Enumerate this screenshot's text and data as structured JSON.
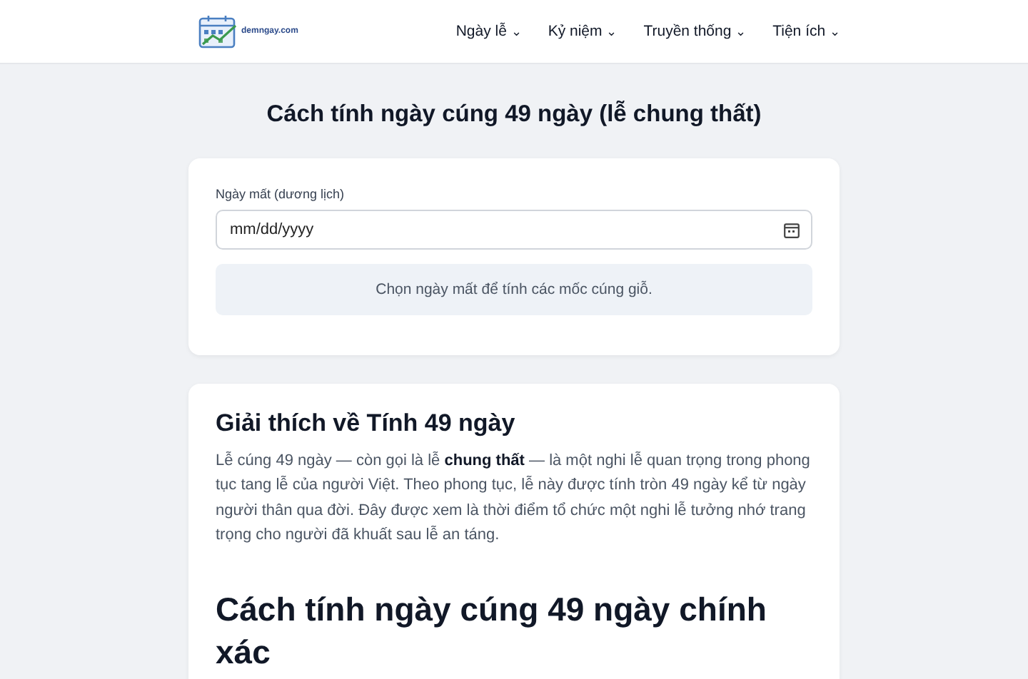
{
  "header": {
    "logo_text": "demngay.com",
    "nav": [
      {
        "label": "Ngày lễ",
        "caret": "⌄"
      },
      {
        "label": "Kỷ niệm",
        "caret": "⌄"
      },
      {
        "label": "Truyền thống",
        "caret": "⌄"
      },
      {
        "label": "Tiện ích",
        "caret": "⌄"
      }
    ]
  },
  "page_title": "Cách tính ngày cúng 49 ngày (lễ chung thất)",
  "form": {
    "label": "Ngày mất (dương lịch)",
    "placeholder": "mm/dd/yyyy",
    "hint": "Chọn ngày mất để tính các mốc cúng giỗ."
  },
  "article": {
    "heading": "Giải thích về Tính 49 ngày",
    "paragraph": "Lễ cúng 49 ngày — còn gọi là lễ **chung thất** — là một nghi lễ quan trọng trong phong tục tang lễ của người Việt. Theo phong tục, lễ này được tính tròn 49 ngày kể từ ngày người thân qua đời. Đây được xem là thời điểm tổ chức một nghi lễ tưởng nhớ trang trọng cho người đã khuất sau lễ an táng.",
    "heading_2": "Cách tính ngày cúng 49 ngày chính xác"
  }
}
